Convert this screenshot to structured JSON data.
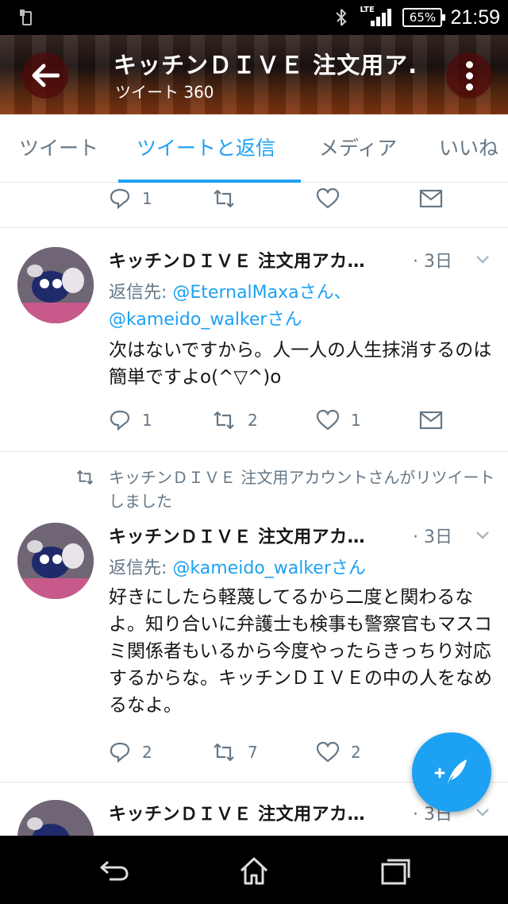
{
  "status_bar": {
    "network": "LTE",
    "battery": "65%",
    "time": "21:59"
  },
  "header": {
    "title": "キッチンＤＩＶＥ 注文用ア.",
    "subtitle": "ツイート 360"
  },
  "tabs": [
    {
      "label": "ツイート"
    },
    {
      "label": "ツイートと返信",
      "active": true
    },
    {
      "label": "メディア"
    },
    {
      "label": "いいね"
    }
  ],
  "top_partial_tweet": {
    "replies": "1",
    "retweets": "",
    "likes": ""
  },
  "tweets": [
    {
      "name": "キッチンＤＩＶＥ 注文用アカ…",
      "time": "· 3日",
      "reply_prefix": "返信先: ",
      "reply_to_1": "@EternalMaxaさん、",
      "reply_to_2": "@kameido_walkerさん",
      "text": "次はないですから。人一人の人生抹消するのは簡単ですよo(^▽^)o",
      "replies": "1",
      "retweets": "2",
      "likes": "1"
    },
    {
      "retweet_note": "キッチンＤＩＶＥ 注文用アカウントさんがリツイートしました",
      "name": "キッチンＤＩＶＥ 注文用アカ…",
      "time": "· 3日",
      "reply_prefix": "返信先: ",
      "reply_to_1": "@kameido_walkerさん",
      "text": "好きにしたら軽蔑してるから二度と関わるなよ。知り合いに弁護士も検事も警察官もマスコミ関係者もいるから今度やったらきっちり対応するからな。キッチンＤＩＶＥの中の人をなめるなよ。",
      "replies": "2",
      "retweets": "7",
      "likes": "2"
    },
    {
      "name": "キッチンＤＩＶＥ 注文用アカ…",
      "time": "· 3日"
    }
  ],
  "colors": {
    "accent": "#1da1f2",
    "muted": "#657786",
    "divider": "#e1e8ed"
  },
  "icons": [
    "back-arrow-icon",
    "more-vertical-icon",
    "reply-icon",
    "retweet-icon",
    "heart-icon",
    "mail-icon",
    "compose-icon",
    "nav-back-icon",
    "nav-home-icon",
    "nav-recents-icon"
  ]
}
